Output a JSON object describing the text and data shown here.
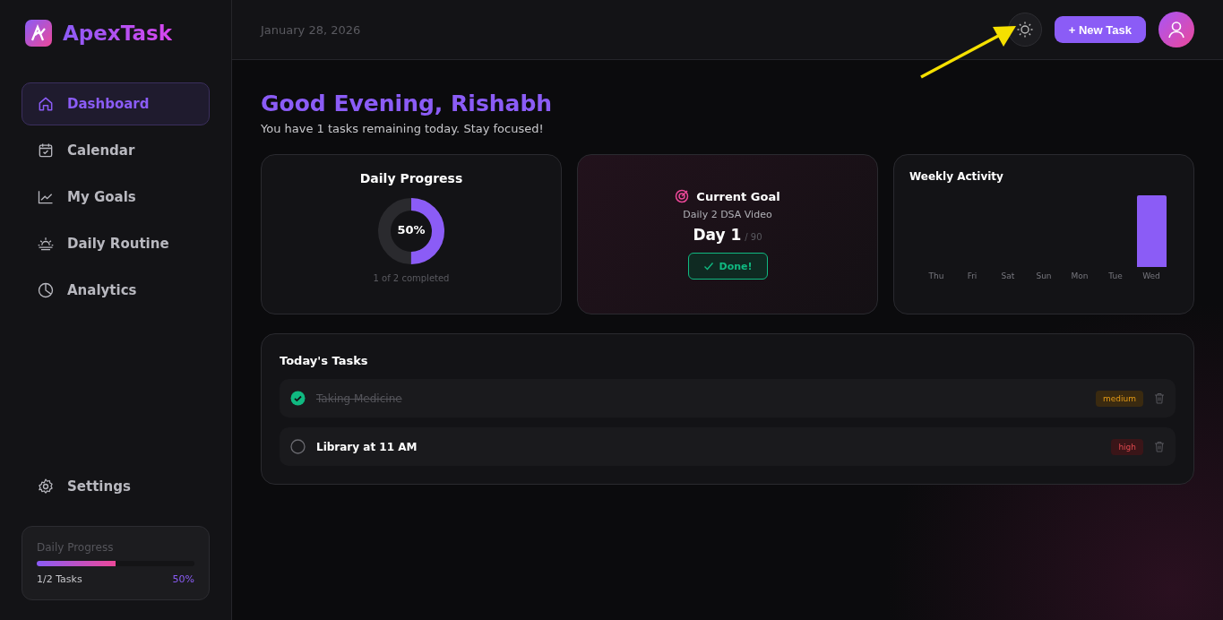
{
  "brand": {
    "name": "ApexTask"
  },
  "sidebar": {
    "items": [
      {
        "label": "Dashboard",
        "selected": true
      },
      {
        "label": "Calendar",
        "selected": false
      },
      {
        "label": "My Goals",
        "selected": false
      },
      {
        "label": "Daily Routine",
        "selected": false
      },
      {
        "label": "Analytics",
        "selected": false
      }
    ],
    "settings": {
      "label": "Settings"
    },
    "progress": {
      "title": "Daily Progress",
      "level": 0.5,
      "tasks": "1/2 Tasks",
      "percent": "50%"
    }
  },
  "header": {
    "date": "January 28, 2026",
    "new_task_button": "+ New Task"
  },
  "greeting": {
    "title": "Good Evening, Rishabh",
    "subtitle": "You have 1 tasks remaining today. Stay focused!"
  },
  "daily_progress": {
    "title": "Daily Progress",
    "level": 0.5,
    "percent": "50%",
    "caption": "1 of 2 completed"
  },
  "current_goal": {
    "title": "Current Goal",
    "name": "Daily 2 DSA Video",
    "day": "Day 1",
    "total": "/ 90",
    "button": "Done!"
  },
  "weekly_activity": {
    "title": "Weekly Activity",
    "days": [
      {
        "label": "Thu",
        "active": false
      },
      {
        "label": "Fri",
        "active": false
      },
      {
        "label": "Sat",
        "active": false
      },
      {
        "label": "Sun",
        "active": false
      },
      {
        "label": "Mon",
        "active": false
      },
      {
        "label": "Tue",
        "active": false
      },
      {
        "label": "Wed",
        "active": true
      }
    ]
  },
  "tasks": {
    "title": "Today's Tasks",
    "items": [
      {
        "label": "Taking Medicine",
        "checked": true,
        "priority": "medium"
      },
      {
        "label": "Library at 11 AM",
        "checked": false,
        "priority": "high"
      }
    ]
  }
}
